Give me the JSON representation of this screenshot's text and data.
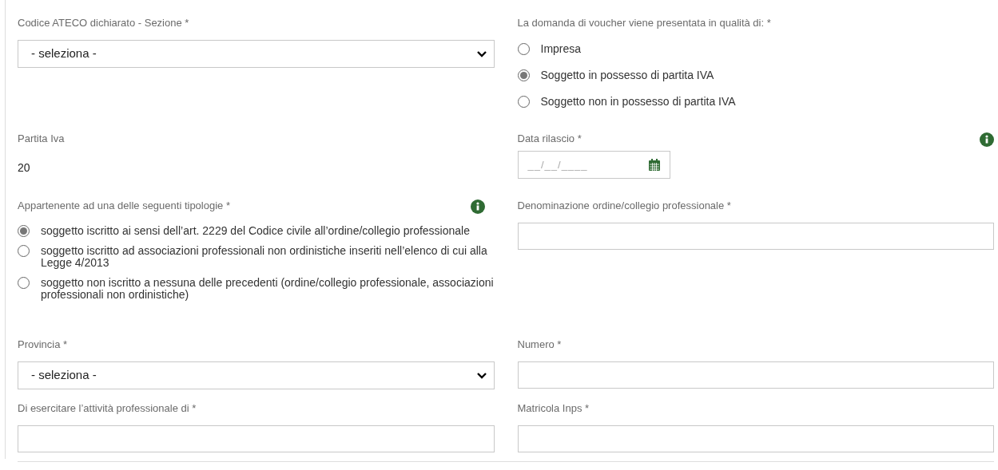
{
  "ateco": {
    "label": "Codice ATECO dichiarato - Sezione *",
    "value": "- seleziona -"
  },
  "qualita": {
    "label": "La domanda di voucher viene presentata in qualità di: *",
    "options": [
      {
        "label": "Impresa",
        "selected": false
      },
      {
        "label": "Soggetto in possesso di partita IVA",
        "selected": true
      },
      {
        "label": "Soggetto non in possesso di partita IVA",
        "selected": false
      }
    ]
  },
  "partita_iva": {
    "label": "Partita Iva",
    "value": "20"
  },
  "data_rilascio": {
    "label": "Data rilascio *",
    "placeholder": "__/__/____"
  },
  "tipologie": {
    "label": "Appartenente ad una delle seguenti tipologie *",
    "options": [
      {
        "label": "soggetto iscritto ai sensi dell’art. 2229 del Codice civile all’ordine/collegio professionale",
        "selected": true
      },
      {
        "label": "soggetto iscritto ad associazioni professionali non ordinistiche inseriti nell’elenco di cui alla Legge 4/2013",
        "selected": false
      },
      {
        "label": "soggetto non iscritto a nessuna delle precedenti (ordine/collegio professionale, associazioni professionali non ordinistiche)",
        "selected": false
      }
    ]
  },
  "denominazione": {
    "label": "Denominazione ordine/collegio professionale *"
  },
  "provincia": {
    "label": "Provincia *",
    "value": "- seleziona -"
  },
  "numero": {
    "label": "Numero *"
  },
  "attivita": {
    "label": "Di esercitare l’attività professionale di *"
  },
  "matricola": {
    "label": "Matricola Inps *"
  }
}
